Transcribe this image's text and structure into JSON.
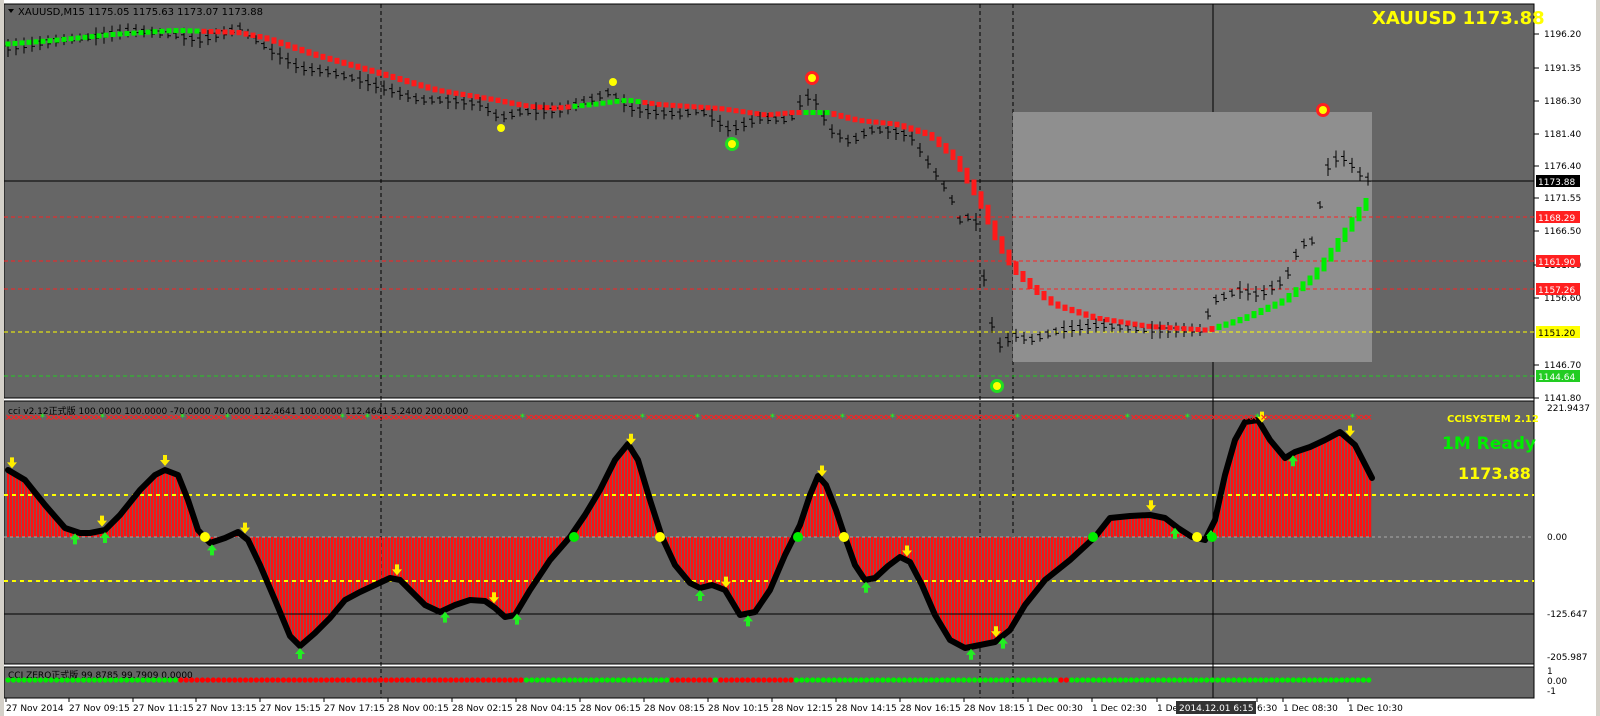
{
  "window": {
    "symbol_header": "XAUUSD,M15  1175.05 1175.63 1173.07 1173.88",
    "big_quote": "XAUUSD  1173.88"
  },
  "main_chart": {
    "price_ticks": [
      "1196.20",
      "1191.35",
      "1186.30",
      "1181.40",
      "1176.40",
      "1171.55",
      "1166.50",
      "1161.60",
      "1156.60",
      "1146.70",
      "1141.80"
    ],
    "current_price": "1173.88",
    "level_labels": [
      {
        "text": "1168.29",
        "color": "#ff2020"
      },
      {
        "text": "1161.90",
        "color": "#ff2020"
      },
      {
        "text": "1157.26",
        "color": "#ff2020"
      },
      {
        "text": "1151.20",
        "color": "#ffff00"
      },
      {
        "text": "1144.64",
        "color": "#22cc22"
      }
    ],
    "colors": {
      "up": "#00ee00",
      "down": "#ff1a1a",
      "bar": "#000000",
      "bg": "#666666",
      "box": "#8f8f8f"
    }
  },
  "cci_panel": {
    "label": "cci v2.12正式版 100.0000 100.0000 -70.0000 70.0000 112.4641 100.0000 112.4641 5.2400 200.0000",
    "system_label": "CCISYSTEM 2.12",
    "status": "1M Ready",
    "price": "1173.88",
    "ticks": [
      "221.9437",
      "0.00",
      "-125.647",
      "-205.987"
    ]
  },
  "zero_panel": {
    "label": "CCI ZERO正式版 99.8785 99.7909 0.0000",
    "ticks": [
      "1",
      "0.00",
      "-1"
    ]
  },
  "time_axis": {
    "labels": [
      "27 Nov 2014",
      "27 Nov 09:15",
      "27 Nov 11:15",
      "27 Nov 13:15",
      "27 Nov 15:15",
      "27 Nov 17:15",
      "28 Nov 00:15",
      "28 Nov 02:15",
      "28 Nov 04:15",
      "28 Nov 06:15",
      "28 Nov 08:15",
      "28 Nov 10:15",
      "28 Nov 12:15",
      "28 Nov 14:15",
      "28 Nov 16:15",
      "28 Nov 18:15",
      "1 Dec 00:30",
      "1 Dec 02:30",
      "1 Dec",
      "6:30",
      "1 Dec 08:30",
      "1 Dec 10:30"
    ],
    "crosshair_time": "2014.12.01 6:15"
  }
}
